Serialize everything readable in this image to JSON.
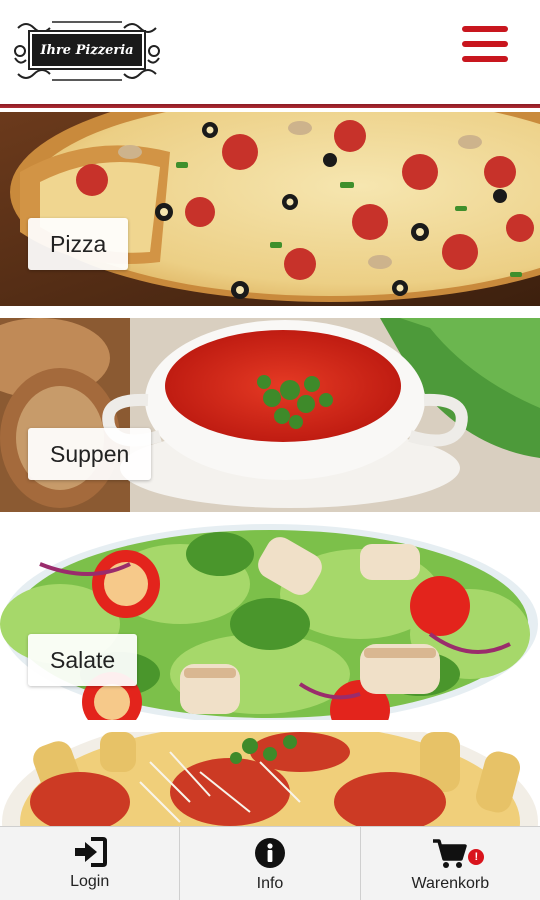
{
  "header": {
    "logo_text": "Ihre Pizzeria",
    "menu_icon": "hamburger-menu-icon",
    "accent_color": "#c8161e"
  },
  "categories": [
    {
      "label": "Pizza"
    },
    {
      "label": "Suppen"
    },
    {
      "label": "Salate"
    },
    {
      "label": ""
    }
  ],
  "footer": {
    "items": [
      {
        "label": "Login",
        "icon": "login-icon"
      },
      {
        "label": "Info",
        "icon": "info-icon"
      },
      {
        "label": "Warenkorb",
        "icon": "cart-icon",
        "badge": "!"
      }
    ]
  }
}
